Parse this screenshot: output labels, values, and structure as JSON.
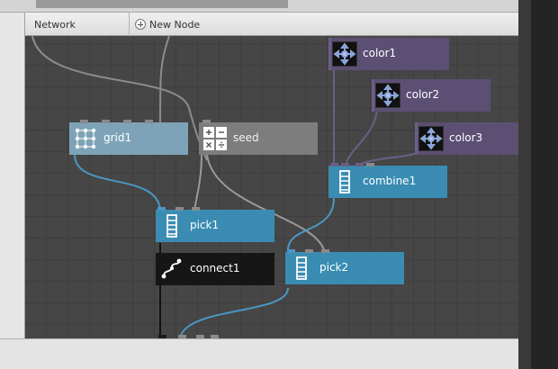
{
  "toolbar": {
    "network_label": "Network",
    "new_node_label": "New Node"
  },
  "nodes": {
    "grid1": {
      "label": "grid1",
      "icon": "grid-icon"
    },
    "seed": {
      "label": "seed",
      "icon": "seed-icon"
    },
    "color1": {
      "label": "color1",
      "icon": "color-icon"
    },
    "color2": {
      "label": "color2",
      "icon": "color-icon"
    },
    "color3": {
      "label": "color3",
      "icon": "color-icon"
    },
    "combine1": {
      "label": "combine1",
      "icon": "list-icon"
    },
    "pick1": {
      "label": "pick1",
      "icon": "list-icon"
    },
    "connect1": {
      "label": "connect1",
      "icon": "connect-icon"
    },
    "pick2": {
      "label": "pick2",
      "icon": "list-icon"
    }
  },
  "colors": {
    "geometry_node": "#7ea3b8",
    "math_node": "#7d7d7d",
    "color_node": "#5c4f74",
    "list_node": "#3a8cb2",
    "selected_node": "#161616",
    "wire_list": "#4a97c4",
    "wire_color": "#6b5f86",
    "wire_grey": "#8c8c8c"
  }
}
